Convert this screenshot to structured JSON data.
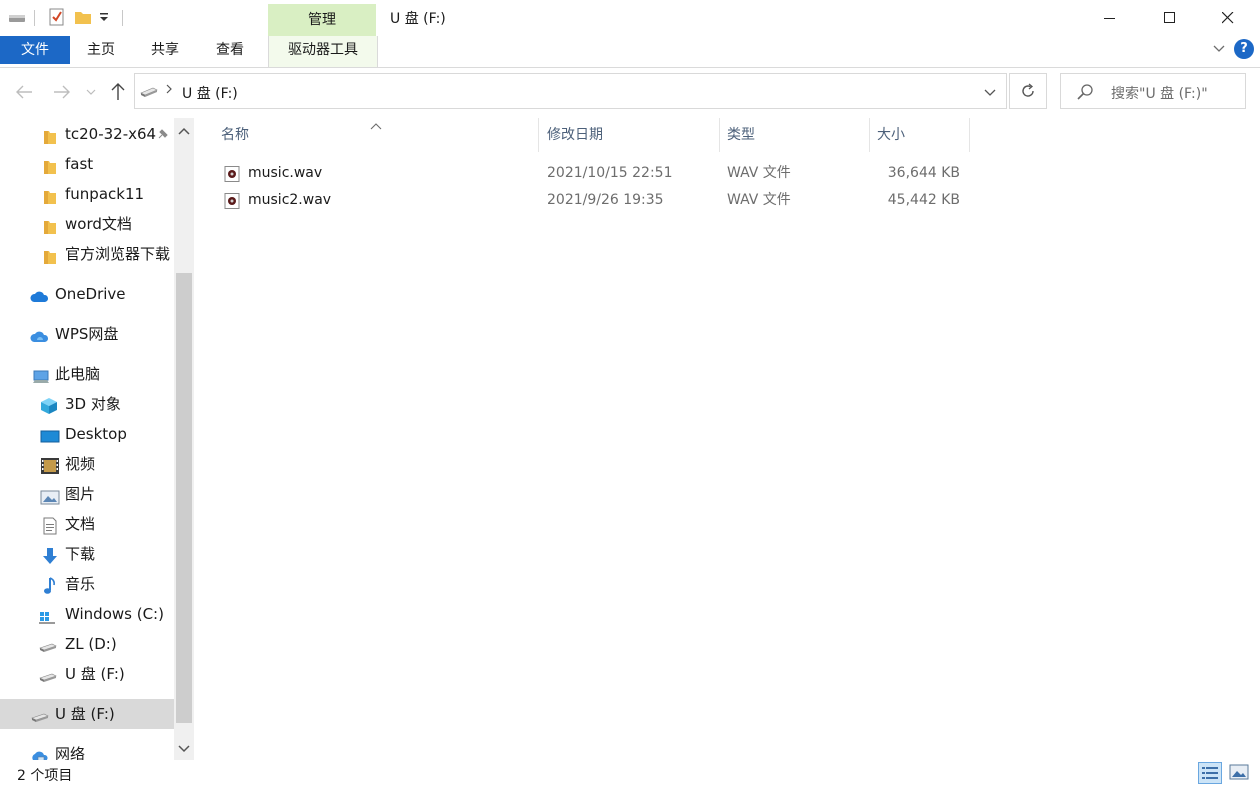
{
  "window": {
    "title": "U 盘 (F:)",
    "manage_tab": "管理",
    "drive_tools_tab": "驱动器工具"
  },
  "ribbon": {
    "file": "文件",
    "home": "主页",
    "share": "共享",
    "view": "查看",
    "help": "?"
  },
  "address": {
    "path": "U 盘 (F:)",
    "search_placeholder": "搜索\"U 盘 (F:)\""
  },
  "nav": {
    "quick": [
      {
        "label": "tc20-32-x64",
        "icon": "folder-icon",
        "pinned": true
      },
      {
        "label": "fast",
        "icon": "folder-icon"
      },
      {
        "label": "funpack11",
        "icon": "folder-icon"
      },
      {
        "label": "word文档",
        "icon": "folder-icon"
      },
      {
        "label": "官方浏览器下载",
        "icon": "folder-icon"
      }
    ],
    "onedrive": "OneDrive",
    "wps": "WPS网盘",
    "this_pc": "此电脑",
    "pc_items": [
      {
        "label": "3D 对象",
        "icon": "3d-objects-icon"
      },
      {
        "label": "Desktop",
        "icon": "desktop-icon"
      },
      {
        "label": "视频",
        "icon": "video-icon"
      },
      {
        "label": "图片",
        "icon": "pictures-icon"
      },
      {
        "label": "文档",
        "icon": "documents-icon"
      },
      {
        "label": "下载",
        "icon": "download-icon"
      },
      {
        "label": "音乐",
        "icon": "music-icon"
      },
      {
        "label": "Windows (C:)",
        "icon": "windows-drive-icon"
      },
      {
        "label": "ZL (D:)",
        "icon": "drive-icon"
      },
      {
        "label": "U 盘 (F:)",
        "icon": "usb-drive-icon"
      }
    ],
    "usb_root": "U 盘 (F:)",
    "network": "网络"
  },
  "columns": {
    "name": "名称",
    "modified": "修改日期",
    "type": "类型",
    "size": "大小"
  },
  "files": [
    {
      "name": "music.wav",
      "modified": "2021/10/15 22:51",
      "type": "WAV 文件",
      "size": "36,644 KB"
    },
    {
      "name": "music2.wav",
      "modified": "2021/9/26 19:35",
      "type": "WAV 文件",
      "size": "45,442 KB"
    }
  ],
  "status": {
    "count": "2 个项目"
  },
  "colors": {
    "accent": "#1c68c6",
    "manage_tab": "#d9efc3",
    "selected": "#d9d9d9"
  }
}
